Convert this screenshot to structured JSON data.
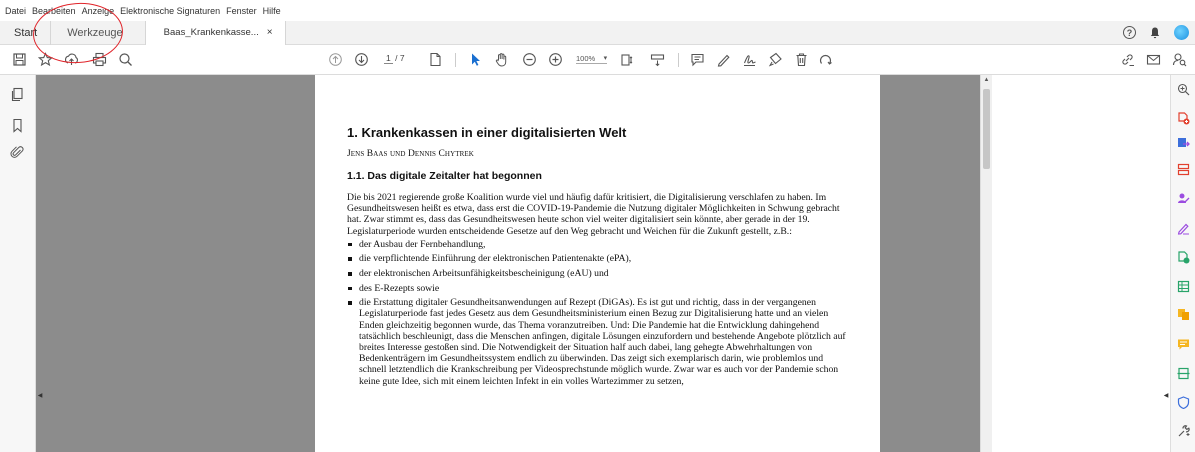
{
  "menu": [
    "Datei",
    "Bearbeiten",
    "Anzeige",
    "Elektronische Signaturen",
    "Fenster",
    "Hilfe"
  ],
  "tabs": {
    "start": "Start",
    "tools": "Werkzeuge",
    "document": "Baas_Krankenkasse...",
    "close": "×"
  },
  "toolbar": {
    "current_page": "1",
    "total_pages": "/ 7",
    "zoom": "100%"
  },
  "document": {
    "title": "1. Krankenkassen in einer digitalisierten Welt",
    "authors": "Jens Baas und Dennis Chytrek",
    "section": "1.1. Das digitale Zeitalter hat begonnen",
    "paragraph": "Die bis 2021 regierende große Koalition wurde viel und häufig dafür kritisiert, die Digitalisierung verschlafen zu haben. Im Gesundheitswesen heißt es etwa, dass erst die COVID-19-Pandemie die Nutzung digitaler Möglichkeiten in Schwung gebracht hat. Zwar stimmt es, dass das Gesundheitswesen heute schon viel weiter digitalisiert sein könnte, aber gerade in der 19. Legislaturperiode wurden entscheidende Gesetze auf den Weg gebracht und Weichen für die Zukunft gestellt, z.B.:",
    "bullets": [
      "der Ausbau der Fernbehandlung,",
      "die verpflichtende Einführung der elektronischen Patientenakte (ePA),",
      "der elektronischen Arbeitsunfähigkeitsbescheinigung (eAU) und",
      "des E-Rezepts sowie",
      "die Erstattung digitaler Gesundheitsanwendungen auf Rezept (DiGAs). Es ist gut und richtig, dass in der vergangenen Legislaturperiode fast jedes Gesetz aus dem Gesundheitsministerium einen Bezug zur Digitalisierung hatte und an vielen Enden gleichzeitig begonnen wurde, das Thema voranzutreiben. Und: Die Pandemie hat die Entwicklung dahingehend tatsächlich beschleunigt, dass die Menschen anfingen, digitale Lösungen einzufordern und bestehende Angebote plötzlich auf breites Interesse gestoßen sind. Die Notwendigkeit der Situation half auch dabei, lang gehegte Abwehrhaltungen von Bedenkenträgern im Gesundheitssystem endlich zu überwinden. Das zeigt sich exemplarisch darin, wie problemlos und schnell letztendlich die Krankschreibung per Videosprechstunde möglich wurde. Zwar war es auch vor der Pandemie schon keine gute Idee, sich mit einem leichten Infekt in ein volles Wartezimmer zu setzen,"
    ]
  },
  "colors": {
    "annotation": "#e0242a",
    "pane_gray": "#8c8c8c"
  }
}
